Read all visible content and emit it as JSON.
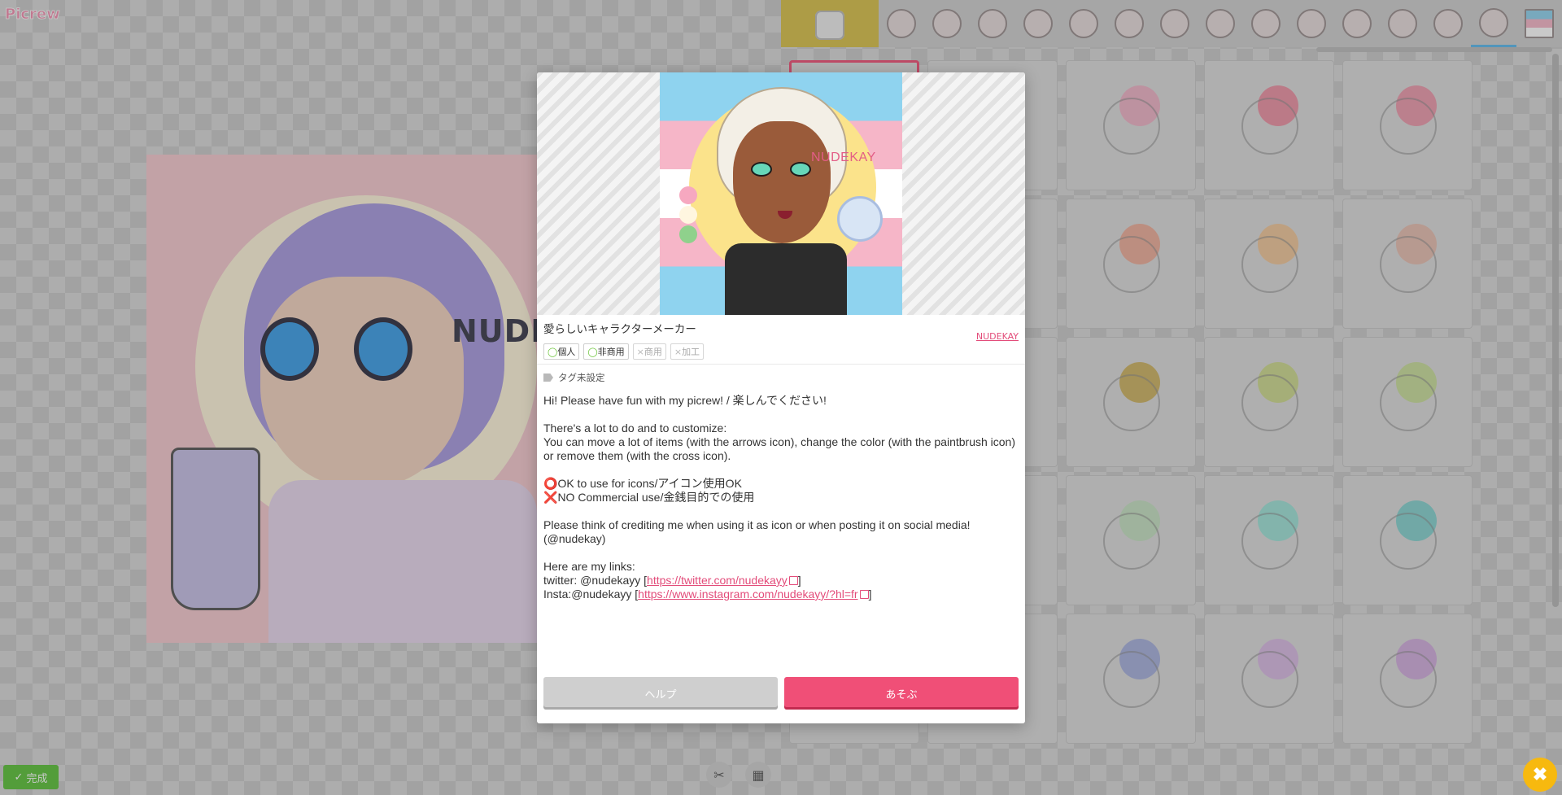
{
  "app": {
    "logo_text": "Picrew"
  },
  "background": {
    "watermark": "NUDE",
    "done_label": "完成",
    "tools": [
      "crossed-tools-icon",
      "grid-icon"
    ]
  },
  "parts_panel": {
    "tab_count": 15,
    "active_tab": 14
  },
  "modal": {
    "thumbnail_watermark": "NUDEKAY",
    "title": "愛らしいキャラクターメーカー",
    "creator": "NUDEKAY",
    "badges": [
      {
        "mark": "◯",
        "label": "個人",
        "allowed": true
      },
      {
        "mark": "◯",
        "label": "非商用",
        "allowed": true
      },
      {
        "mark": "×",
        "label": "商用",
        "allowed": false
      },
      {
        "mark": "×",
        "label": "加工",
        "allowed": false
      }
    ],
    "tag_text": "タグ未設定",
    "description": {
      "line1": "Hi! Please have fun with my picrew! / 楽しんでください!",
      "line2": "There's a lot to do and to customize:",
      "line3": "You can move a lot of items (with the arrows icon), change the color (with the paintbrush icon) or remove them (with the cross icon).",
      "ok_mark": "⭕",
      "ok_text": "OK to use for icons/アイコン使用OK",
      "no_mark": "❌",
      "no_text": "NO Commercial use/金銭目的での使用",
      "credit": "Please think of crediting me when using it as icon or when posting it on social media! (@nudekay)",
      "links_heading": "Here are my links:",
      "twitter_prefix": "twitter: @nudekayy [",
      "twitter_url": "https://twitter.com/nudekayy",
      "insta_prefix": "Insta:@nudekayy [",
      "insta_url": "https://www.instagram.com/nudekayy/?hl=fr",
      "bracket_close": "]"
    },
    "help_label": "ヘルプ",
    "play_label": "あそぶ"
  },
  "colors": {
    "accent_pink": "#f04f77",
    "close_fab": "#f7b90f",
    "done_green": "#5cc23a"
  }
}
